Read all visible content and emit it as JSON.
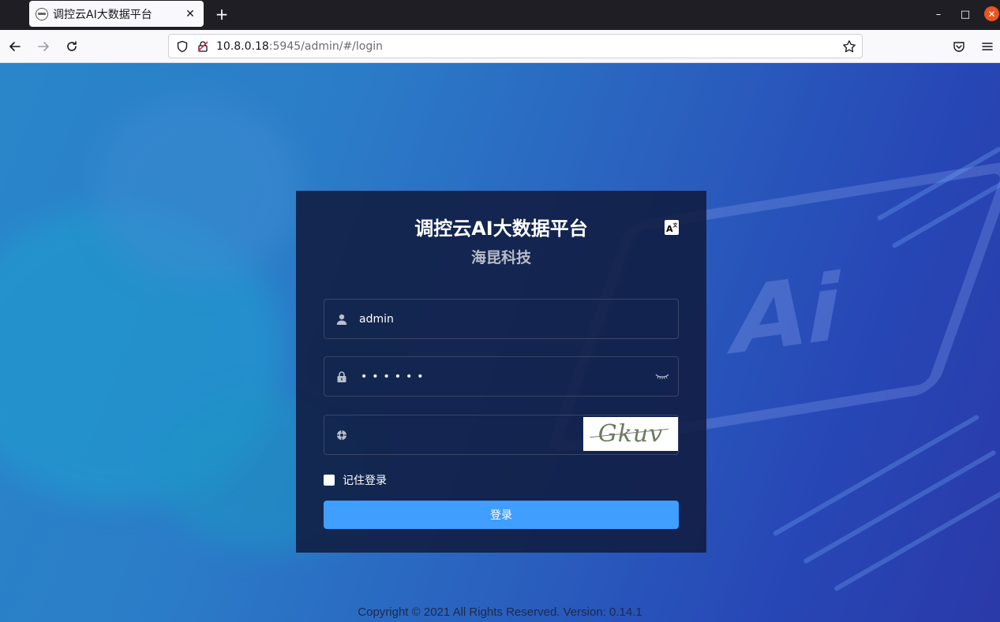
{
  "browser": {
    "tab_title": "调控云AI大数据平台",
    "tab_close": "✕",
    "new_tab": "+",
    "url_host": "10.8.0.18",
    "url_path": ":5945/admin/#/login",
    "icons": {
      "back": "back-arrow-icon",
      "forward": "forward-arrow-icon",
      "reload": "reload-icon",
      "shield": "tracking-shield-icon",
      "insecure": "insecure-lock-icon",
      "bookmark": "star-icon",
      "pocket": "pocket-icon",
      "menu": "hamburger-menu-icon"
    },
    "window_controls": {
      "minimize": "–",
      "maximize": "□",
      "close": "✕"
    }
  },
  "login": {
    "title": "调控云AI大数据平台",
    "subtitle": "海昆科技",
    "lang_icon_label": "A",
    "lang_icon_sup": "文",
    "username_value": "admin",
    "password_dots": "••••••",
    "captcha_text": "Gkuv",
    "remember_label": "记住登录",
    "remember_checked": false,
    "submit_label": "登录"
  },
  "footer": {
    "copyright": "Copyright © 2021 All Rights Reserved. Version: 0.14.1"
  },
  "colors": {
    "accent_button": "#409eff",
    "card_bg": "#101b40",
    "page_gradient_start": "#2a86c9",
    "page_gradient_end": "#2a3aa8",
    "window_close": "#e95420"
  }
}
